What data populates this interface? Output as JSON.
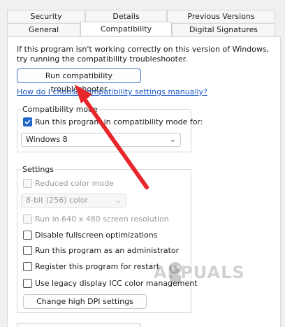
{
  "tabs_row1": [
    {
      "label": "Security"
    },
    {
      "label": "Details"
    },
    {
      "label": "Previous Versions"
    }
  ],
  "tabs_row2": [
    {
      "label": "General"
    },
    {
      "label": "Compatibility"
    },
    {
      "label": "Digital Signatures"
    }
  ],
  "intro": {
    "line1": "If this program isn't working correctly on this version of Windows,",
    "line2": "try running the compatibility troubleshooter."
  },
  "troubleshooter_button": "Run compatibility troubleshooter",
  "manual_link": "How do I choose compatibility settings manually?",
  "compat_mode": {
    "legend": "Compatibility mode",
    "checkbox_label": "Run this program in compatibility mode for:",
    "checked": true,
    "selected_os": "Windows 8"
  },
  "settings": {
    "legend": "Settings",
    "reduced_color_label": "Reduced color mode",
    "color_select": "8-bit (256) color",
    "resolution_label": "Run in 640 x 480 screen resolution",
    "fullscreen_label": "Disable fullscreen optimizations",
    "admin_label": "Run this program as an administrator",
    "restart_label": "Register this program for restart",
    "icc_label": "Use legacy display ICC color management",
    "dpi_button": "Change high DPI settings"
  },
  "watermark": "APPUALS",
  "annotation_color": "#e8262b",
  "accent_color": "#1e66c8"
}
